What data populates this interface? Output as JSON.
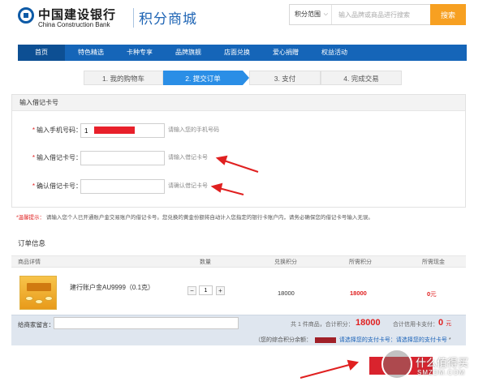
{
  "header": {
    "bank_name_cn": "中国建设银行",
    "bank_name_en": "China Construction Bank",
    "mall_title": "积分商城",
    "search": {
      "scope_label": "积分范围",
      "placeholder": "输入品牌或商品进行搜索",
      "button_label": "搜索"
    }
  },
  "nav": {
    "items": [
      {
        "label": "首页"
      },
      {
        "label": "特色精选"
      },
      {
        "label": "卡种专享"
      },
      {
        "label": "品牌旗舰"
      },
      {
        "label": "店面兑换"
      },
      {
        "label": "爱心捐赠"
      },
      {
        "label": "权益活动"
      }
    ]
  },
  "steps": [
    {
      "label": "1. 我的购物车"
    },
    {
      "label": "2. 提交订单"
    },
    {
      "label": "3. 支付"
    },
    {
      "label": "4. 完成交易"
    }
  ],
  "card_section": {
    "title": "输入借记卡号",
    "fields": [
      {
        "label": "输入手机号码：",
        "value": "1",
        "hint": "请输入您的手机号码"
      },
      {
        "label": "输入借记卡号：",
        "value": "",
        "hint": "请输入借记卡号"
      },
      {
        "label": "确认借记卡号：",
        "value": "",
        "hint": "请确认借记卡号"
      }
    ]
  },
  "tip": {
    "label": "*温馨提示：",
    "text": "请输入您个人已开通账户金交易账户的借记卡号。您兑换的黄金份额将自动计入您指定的银行卡账户内，请务必确保您的借记卡号输入无误。"
  },
  "order": {
    "title": "订单信息",
    "columns": [
      "商品详情",
      "数量",
      "兑换积分",
      "所需积分",
      "所需现金"
    ],
    "item": {
      "name": "建行账户金AU9999（0.1克）",
      "quantity": "1",
      "points": "18000",
      "required_points": "18000",
      "cash": "0",
      "cash_unit": "元"
    },
    "summary": {
      "message_label": "给商家留言：",
      "count_text": "共 1 件商品，合计积分：",
      "total_points": "18000",
      "cash_label": "合计信用卡支付：",
      "total_cash": "0",
      "cash_unit": "元",
      "account_prefix": "（您的综合积分余额：",
      "account_link": "请选择您的支付卡号：请选择您的支付卡号",
      "account_suffix": "*"
    }
  },
  "watermark": {
    "cn": "什么值得买",
    "en": "SMZDM.COM"
  },
  "colors": {
    "brand_blue": "#1565b8",
    "accent_orange": "#f7a021",
    "price_red": "#e02020",
    "step_active": "#2a8ee6",
    "submit_red": "#d9232d"
  }
}
